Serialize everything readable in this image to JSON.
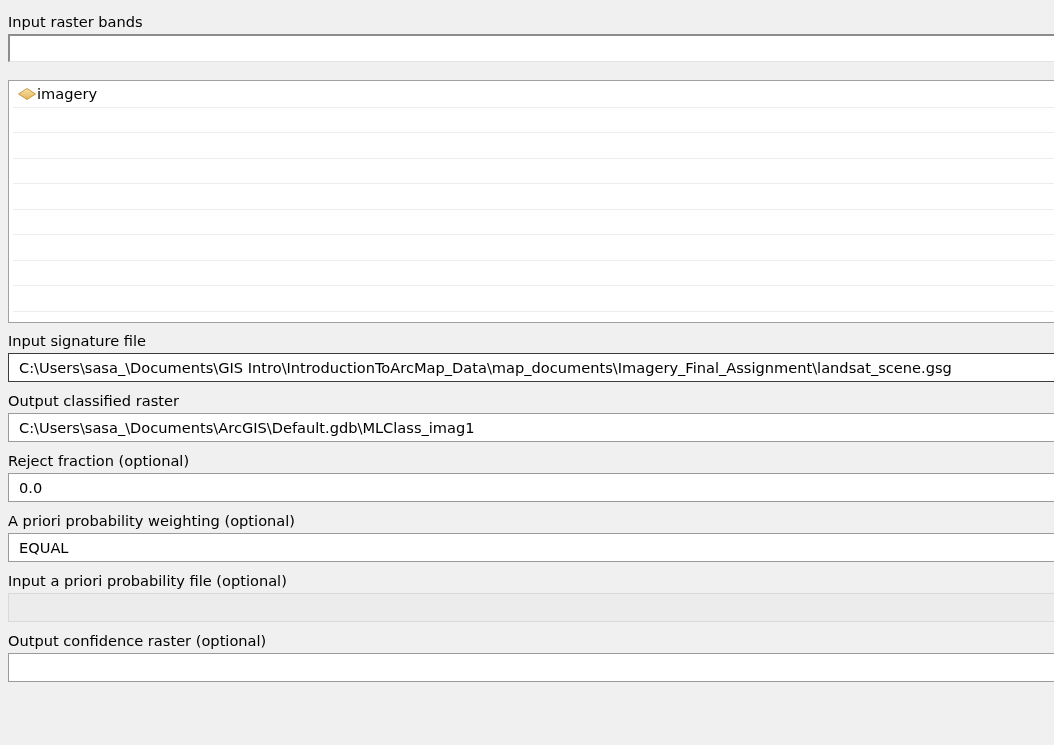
{
  "raster_bands": {
    "label": "Input raster bands",
    "layers": [
      {
        "name": "imagery",
        "selected": false
      }
    ]
  },
  "parameters": [
    {
      "label": "Input signature file",
      "value": "C:\\Users\\sasa_\\Documents\\GIS Intro\\IntroductionToArcMap_Data\\map_documents\\Imagery_Final_Assignment\\landsat_scene.gsg",
      "focused": true,
      "disabled": false
    },
    {
      "label": "Output classified raster",
      "value": "C:\\Users\\sasa_\\Documents\\ArcGIS\\Default.gdb\\MLClass_imag1",
      "focused": false,
      "disabled": false
    },
    {
      "label": "Reject fraction (optional)",
      "value": "0.0",
      "focused": false,
      "disabled": false
    },
    {
      "label": "A priori probability weighting (optional)",
      "value": "EQUAL",
      "focused": false,
      "disabled": false
    },
    {
      "label": "Input a priori probability file (optional)",
      "focused": false,
      "disabled": true
    },
    {
      "label": "Output confidence raster (optional)",
      "focused": false,
      "disabled": false
    }
  ]
}
